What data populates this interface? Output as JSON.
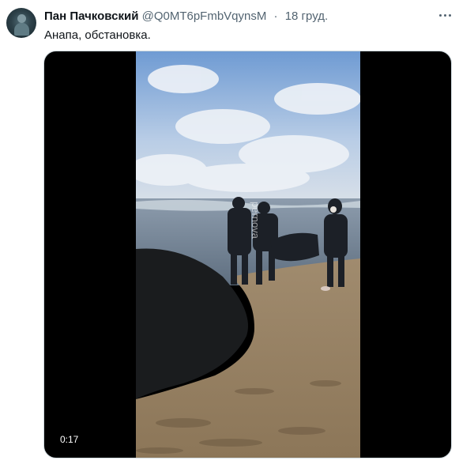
{
  "tweet": {
    "author_name": "Пан Пачковский",
    "handle": "@Q0MT6pFmbVqynsM",
    "separator": "·",
    "date": "18 груд.",
    "text": "Анапа, обстановка.",
    "more_icon": "more-horizontal-icon"
  },
  "video": {
    "timestamp": "0:17",
    "watermark": "pernova"
  }
}
